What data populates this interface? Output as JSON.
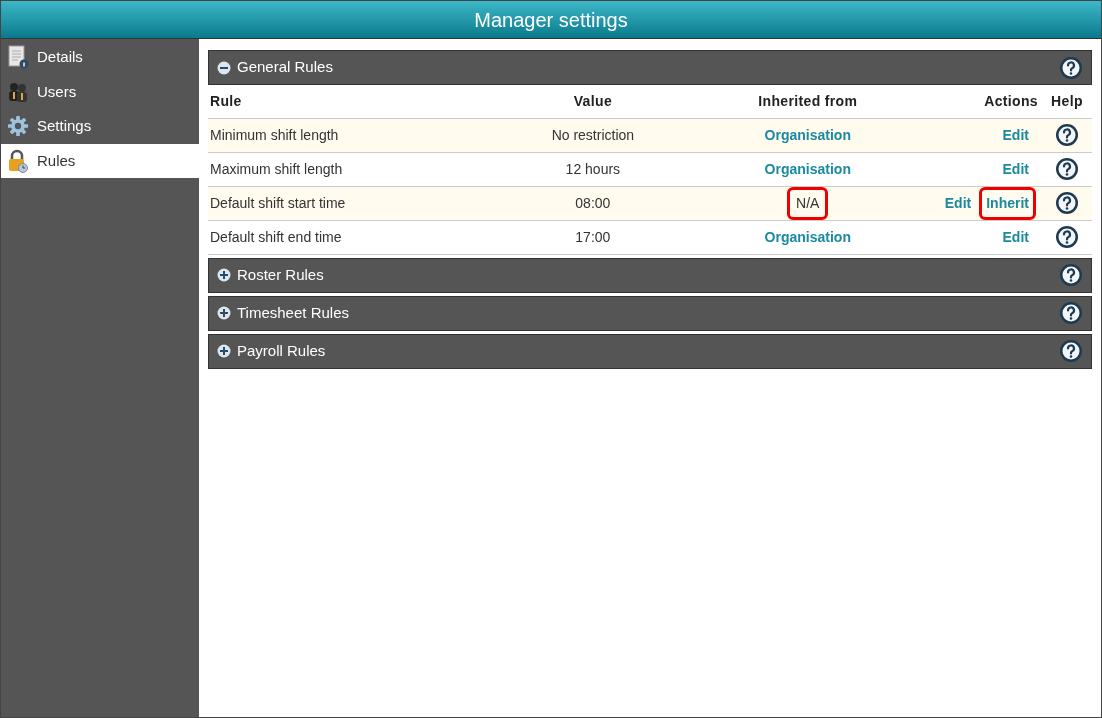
{
  "window": {
    "title": "Manager settings"
  },
  "sidebar": {
    "items": [
      {
        "label": "Details",
        "kind": "document",
        "selected": false
      },
      {
        "label": "Users",
        "kind": "users",
        "selected": false
      },
      {
        "label": "Settings",
        "kind": "gear",
        "selected": false
      },
      {
        "label": "Rules",
        "kind": "lock",
        "selected": true
      }
    ]
  },
  "sections": [
    {
      "title": "General Rules",
      "expanded": true,
      "table": {
        "columns": [
          "Rule",
          "Value",
          "Inherited from",
          "Actions",
          "Help"
        ],
        "rows": [
          {
            "rule": "Minimum shift length",
            "value": "No restriction",
            "inherited_from": {
              "text": "Organisation",
              "linked": true,
              "highlighted": false
            },
            "actions": [
              {
                "label": "Edit",
                "highlighted": false
              }
            ]
          },
          {
            "rule": "Maximum shift length",
            "value": "12 hours",
            "inherited_from": {
              "text": "Organisation",
              "linked": true,
              "highlighted": false
            },
            "actions": [
              {
                "label": "Edit",
                "highlighted": false
              }
            ]
          },
          {
            "rule": "Default shift start time",
            "value": "08:00",
            "inherited_from": {
              "text": "N/A",
              "linked": false,
              "highlighted": true
            },
            "actions": [
              {
                "label": "Edit",
                "highlighted": false
              },
              {
                "label": "Inherit",
                "highlighted": true
              }
            ]
          },
          {
            "rule": "Default shift end time",
            "value": "17:00",
            "inherited_from": {
              "text": "Organisation",
              "linked": true,
              "highlighted": false
            },
            "actions": [
              {
                "label": "Edit",
                "highlighted": false
              }
            ]
          }
        ]
      }
    },
    {
      "title": "Roster Rules",
      "expanded": false
    },
    {
      "title": "Timesheet Rules",
      "expanded": false
    },
    {
      "title": "Payroll Rules",
      "expanded": false
    }
  ]
}
